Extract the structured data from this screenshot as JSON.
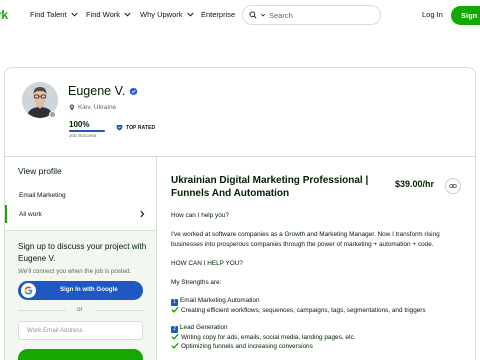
{
  "header": {
    "logo_text": "rk",
    "nav": [
      {
        "label": "Find Talent"
      },
      {
        "label": "Find Work"
      },
      {
        "label": "Why Upwork"
      },
      {
        "label": "Enterprise"
      }
    ],
    "search_placeholder": "Search",
    "login_label": "Log In",
    "signup_label": "Sign",
    "brand_color": "#14a800"
  },
  "profile": {
    "name": "Eugene V.",
    "location": "Kiev, Ukraine",
    "job_success_value": "100%",
    "job_success_fraction": 1.0,
    "job_success_label": "Job Success",
    "badge_label": "TOP RATED",
    "badge_color": "#1f57c3"
  },
  "sidebar": {
    "title": "View profile",
    "items": [
      {
        "label": "Email Marketing"
      },
      {
        "label": "All work"
      }
    ]
  },
  "signup_box": {
    "title": "Sign up to discuss your project with Eugene V.",
    "subtitle": "We'll connect you when the job is posted.",
    "google_label": "Sign In with Google",
    "or_label": "or",
    "email_placeholder": "Work Email Address"
  },
  "main": {
    "headline": "Ukrainian Digital Marketing Professional | Funnels And Automation",
    "rate": "$39.00/hr",
    "lines": [
      "How can I help you?",
      "I've worked at software companies as a Growth and Marketing Manager. Now I transform rising",
      "businesses into prosperous companies through the power of marketing + automation + code.",
      "HOW CAN I HELP YOU?",
      "My Strengths are:"
    ],
    "strength_1": {
      "number": "1",
      "title": "Email Marketing Automation",
      "bullets": [
        "Creating efficient workflows, sequences, campaigns, tags, segmentations, and triggers"
      ]
    },
    "strength_2": {
      "number": "2",
      "title": "Lead Generation",
      "bullets": [
        "Writing copy for ads, emails, social media, landing pages, etc.",
        "Optimizing funnels and increasing conversions"
      ]
    }
  }
}
